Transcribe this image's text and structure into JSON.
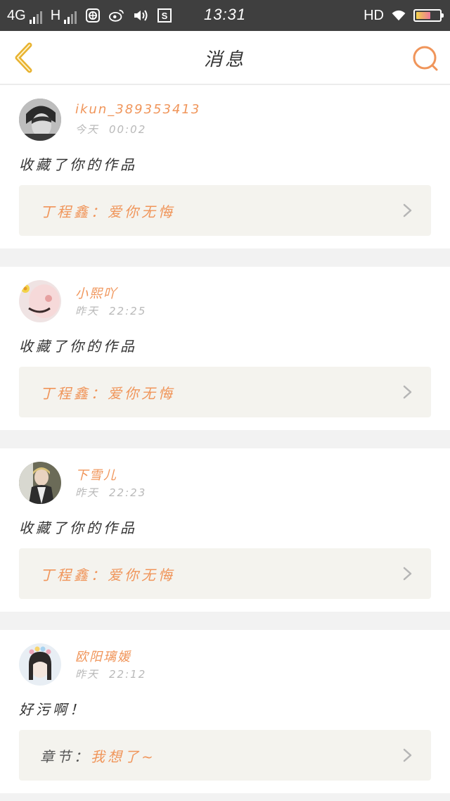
{
  "status_bar": {
    "network_4g": "4G",
    "network_h": "H",
    "time": "13:31",
    "hd": "HD"
  },
  "nav": {
    "title": "消息"
  },
  "colors": {
    "accent": "#f0955a",
    "back_arrow": "#e8b230",
    "ref_bg": "#f4f3ee"
  },
  "messages": [
    {
      "username": "ikun_389353413",
      "day": "今天",
      "time": "00:02",
      "action": "收藏了你的作品",
      "ref_label": "丁程鑫：",
      "ref_content": "爱你无悔"
    },
    {
      "username": "小熙吖",
      "day": "昨天",
      "time": "22:25",
      "action": "收藏了你的作品",
      "ref_label": "丁程鑫：",
      "ref_content": "爱你无悔"
    },
    {
      "username": "下雪儿",
      "day": "昨天",
      "time": "22:23",
      "action": "收藏了你的作品",
      "ref_label": "丁程鑫：",
      "ref_content": "爱你无悔"
    },
    {
      "username": "欧阳璃媛",
      "day": "昨天",
      "time": "22:12",
      "action": "好污啊！",
      "ref_label": "章节：",
      "ref_content": "我想了~"
    }
  ]
}
